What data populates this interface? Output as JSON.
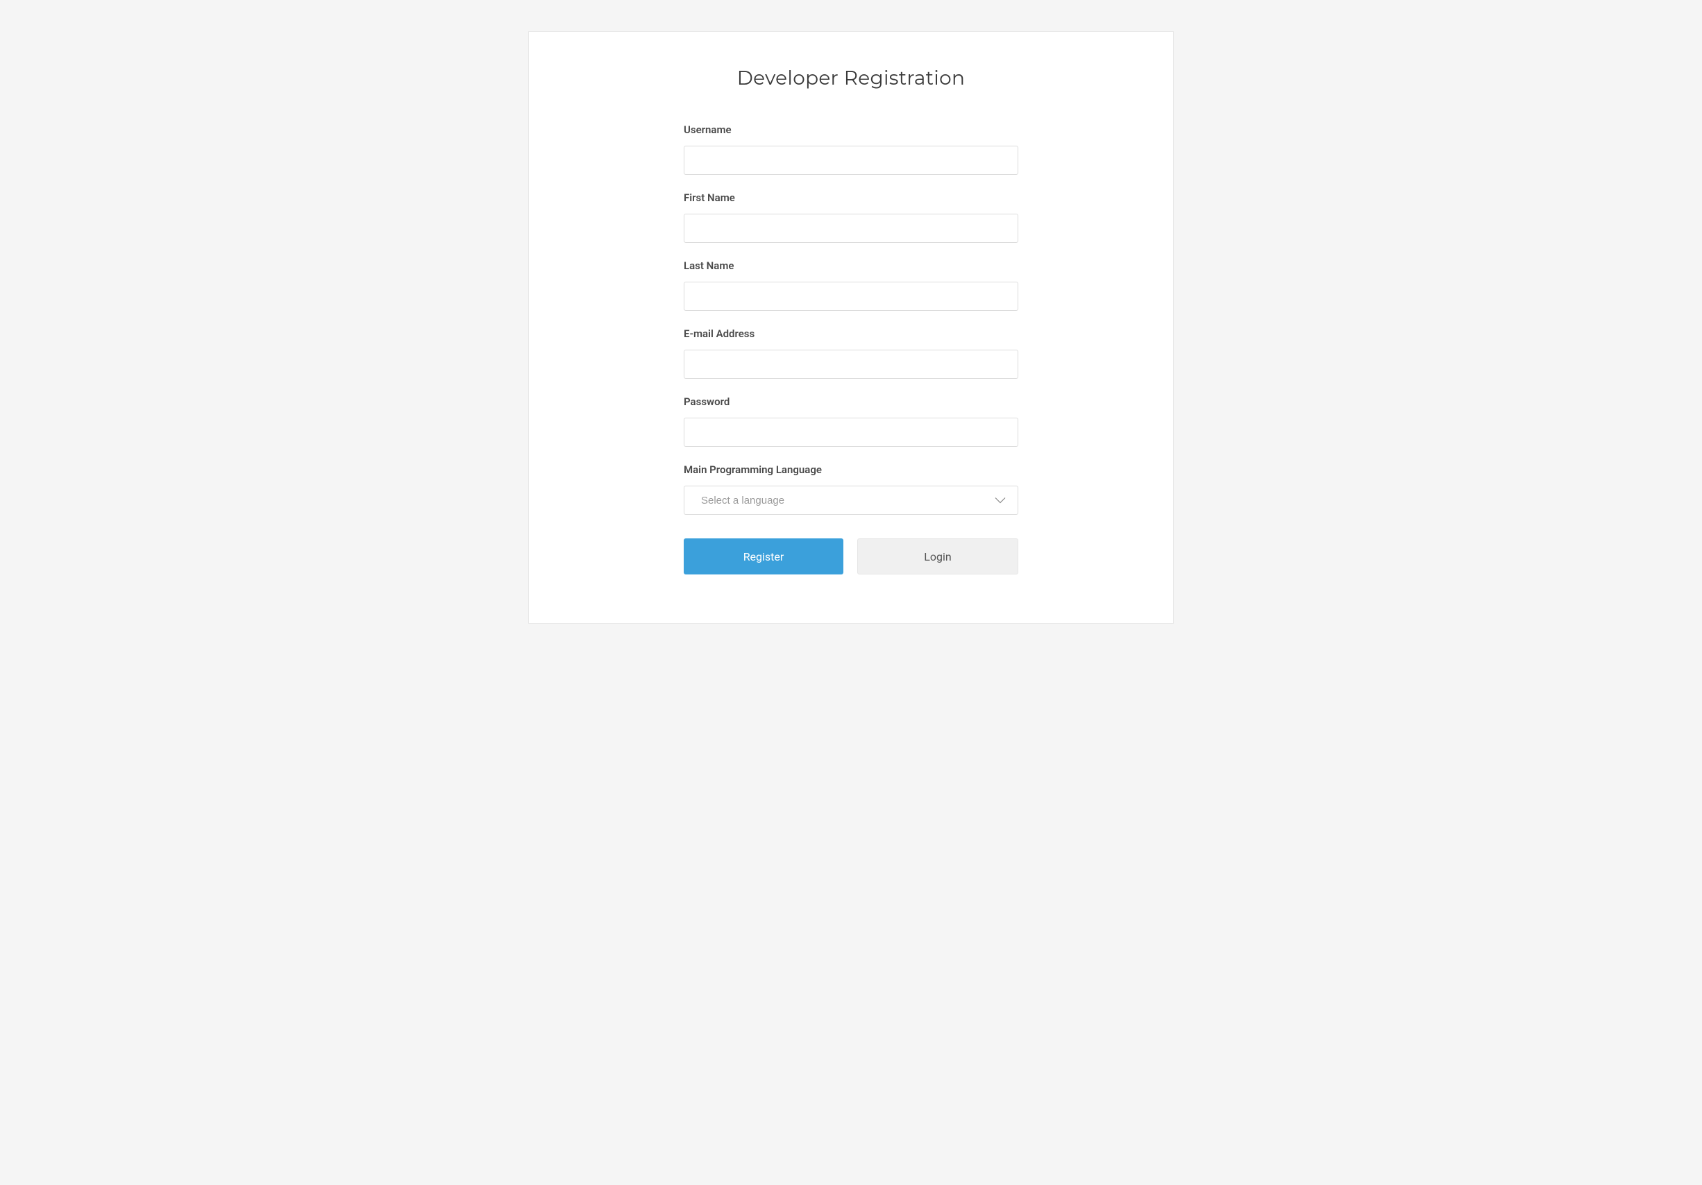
{
  "page": {
    "title": "Developer Registration"
  },
  "form": {
    "username": {
      "label": "Username",
      "value": ""
    },
    "first_name": {
      "label": "First Name",
      "value": ""
    },
    "last_name": {
      "label": "Last Name",
      "value": ""
    },
    "email": {
      "label": "E-mail Address",
      "value": ""
    },
    "password": {
      "label": "Password",
      "value": ""
    },
    "language": {
      "label": "Main Programming Language",
      "placeholder": "Select a language"
    }
  },
  "buttons": {
    "register": "Register",
    "login": "Login"
  }
}
